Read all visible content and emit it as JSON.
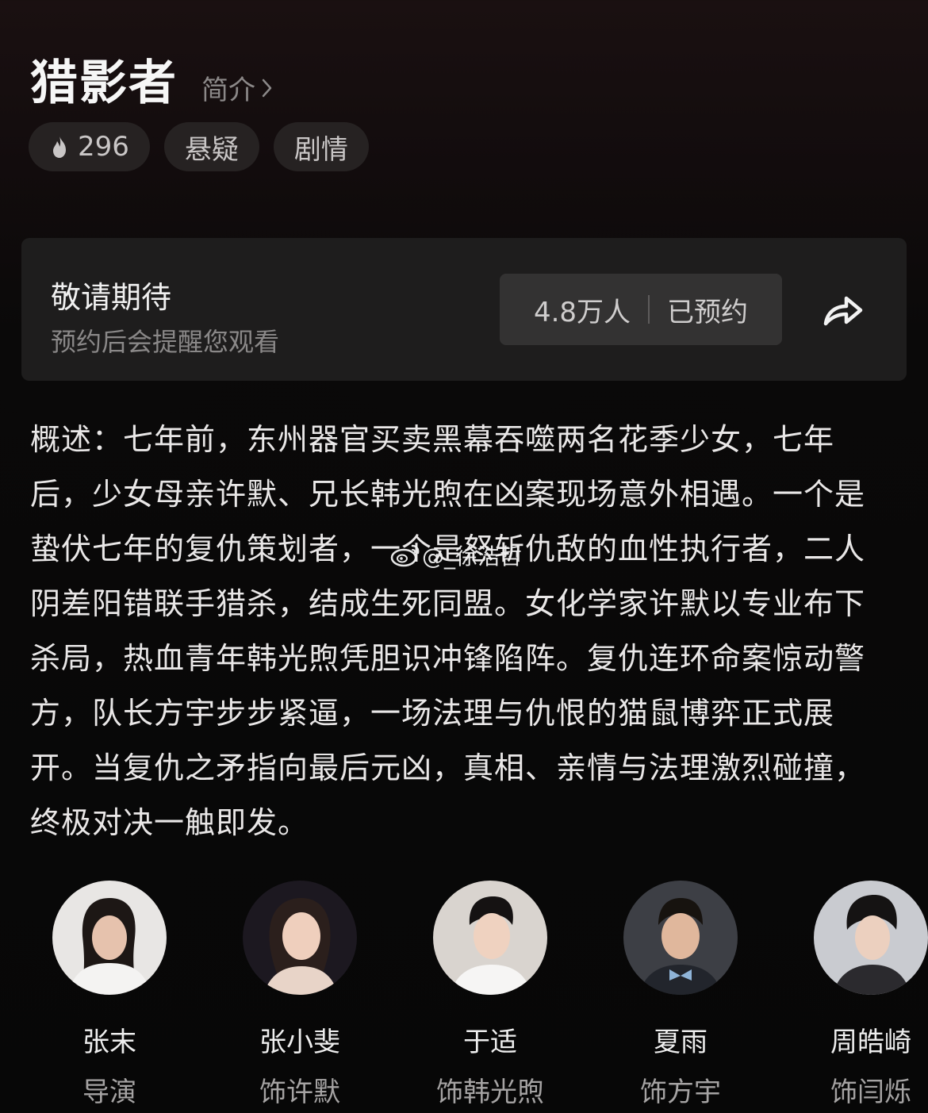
{
  "header": {
    "title": "猎影者",
    "intro_label": "简介",
    "chevron_icon": "chevron-right-icon"
  },
  "tags": [
    {
      "icon": "flame-icon",
      "label": "296"
    },
    {
      "label": "悬疑"
    },
    {
      "label": "剧情"
    }
  ],
  "reservation": {
    "title": "敬请期待",
    "subtitle": "预约后会提醒您观看",
    "count": "4.8万人",
    "status": "已预约",
    "share_icon": "share-arrow-icon"
  },
  "synopsis": "概述：七年前，东州器官买卖黑幕吞噬两名花季少女，七年后，少女母亲许默、兄长韩光煦在凶案现场意外相遇。一个是蛰伏七年的复仇策划者，一个是怒斩仇敌的血性执行者，二人阴差阳错联手猎杀，结成生死同盟。女化学家许默以专业布下杀局，热血青年韩光煦凭胆识冲锋陷阵。复仇连环命案惊动警方，队长方宇步步紧逼，一场法理与仇恨的猫鼠博弈正式展开。当复仇之矛指向最后元凶，真相、亲情与法理激烈碰撞，终极对决一触即发。",
  "watermark": {
    "icon": "weibo-icon",
    "text": "@_徐浩哲"
  },
  "cast": [
    {
      "name": "张末",
      "role": "导演"
    },
    {
      "name": "张小斐",
      "role": "饰许默"
    },
    {
      "name": "于适",
      "role": "饰韩光煦"
    },
    {
      "name": "夏雨",
      "role": "饰方宇"
    },
    {
      "name": "周皓崎",
      "role": "饰闫烁"
    }
  ]
}
